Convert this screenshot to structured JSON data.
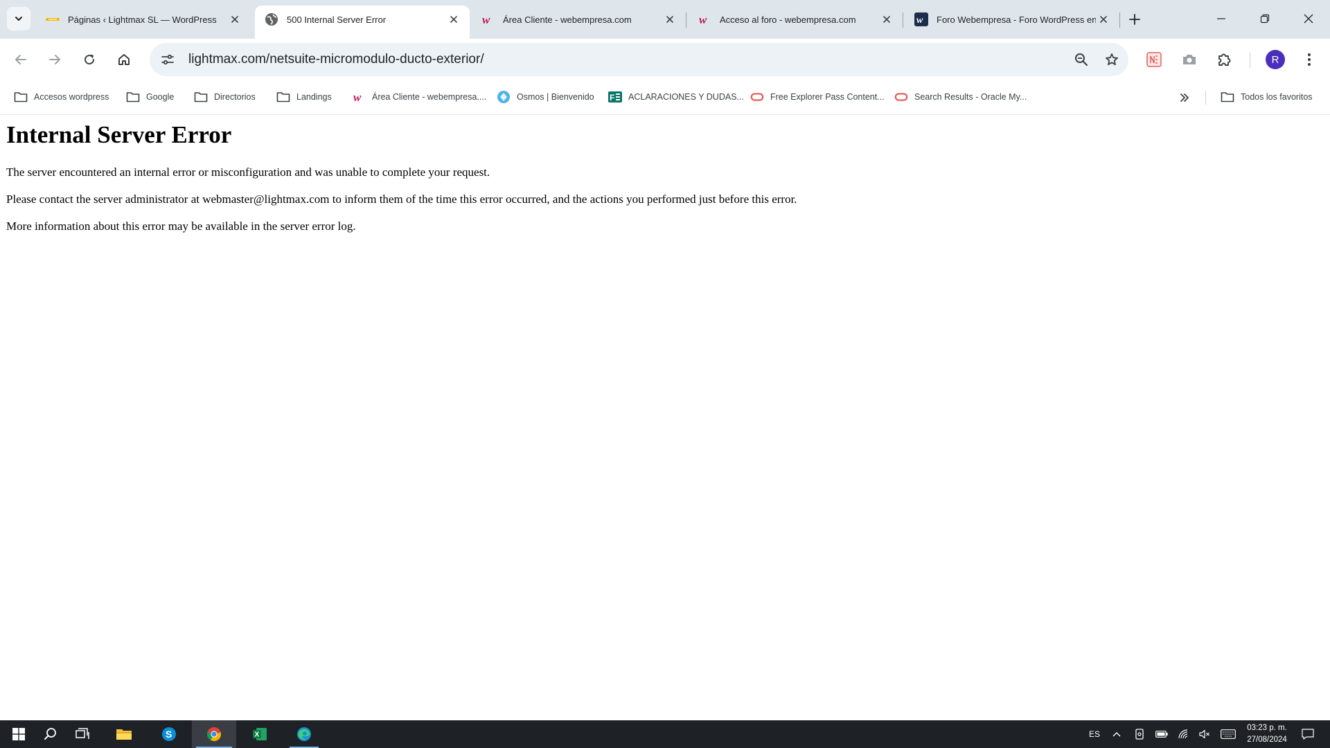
{
  "browser": {
    "tabs": [
      {
        "title": "Páginas ‹ Lightmax SL — WordPress",
        "active": false
      },
      {
        "title": "500 Internal Server Error",
        "active": true
      },
      {
        "title": "Área Cliente - webempresa.com",
        "active": false
      },
      {
        "title": "Acceso al foro - webempresa.com",
        "active": false
      },
      {
        "title": "Foro Webempresa - Foro WordPress en español",
        "active": false
      }
    ],
    "address_bar": {
      "url": "lightmax.com/netsuite-micromodulo-ducto-exterior/"
    },
    "profile_initial": "R",
    "bookmarks": [
      {
        "label": "Accesos wordpress",
        "icon": "folder-icon"
      },
      {
        "label": "Google",
        "icon": "folder-icon"
      },
      {
        "label": "Directorios",
        "icon": "folder-icon"
      },
      {
        "label": "Landings",
        "icon": "folder-icon"
      },
      {
        "label": "Área Cliente - webempresa....",
        "icon": "webempresa-icon"
      },
      {
        "label": "Osmos | Bienvenido",
        "icon": "osmos-icon"
      },
      {
        "label": "ACLARACIONES Y DUDAS...",
        "icon": "forms-icon"
      },
      {
        "label": "Free Explorer Pass Content...",
        "icon": "oracle-icon"
      },
      {
        "label": "Search Results - Oracle My...",
        "icon": "oracle-icon"
      }
    ],
    "all_bookmarks_label": "Todos los favoritos"
  },
  "page": {
    "heading": "Internal Server Error",
    "paragraphs": [
      "The server encountered an internal error or misconfiguration and was unable to complete your request.",
      "Please contact the server administrator at webmaster@lightmax.com to inform them of the time this error occurred, and the actions you performed just before this error.",
      "More information about this error may be available in the server error log."
    ]
  },
  "taskbar": {
    "language": "ES",
    "time": "03:23 p. m.",
    "date": "27/08/2024"
  },
  "colors": {
    "tab_strip": "#dfe6eb",
    "omnibox": "#edf2f6",
    "webempresa_brand": "#c2185b",
    "oracle_red": "#e05a4f",
    "avatar": "#4a2fbd",
    "taskbar": "#1e2125",
    "taskbar_active_underline": "#76b9ed"
  }
}
